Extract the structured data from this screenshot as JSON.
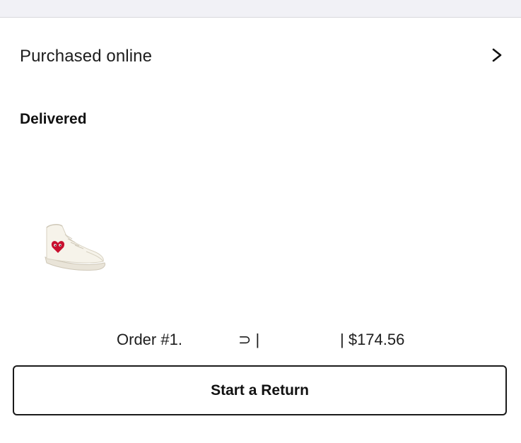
{
  "purchase": {
    "label": "Purchased online",
    "chevron_icon": "chevron-right-icon"
  },
  "order_status": "Delivered",
  "product": {
    "image_icon": "high-top-sneaker-image"
  },
  "order_summary": {
    "order_prefix": "Order #1.",
    "mid_fragment": "⊃ |",
    "price": "| $174.56"
  },
  "actions": {
    "start_return_label": "Start a Return"
  },
  "colors": {
    "top_strip": "#f1f1f6",
    "text": "#1d1d1d",
    "button_border": "#1a1a1a",
    "heart_red": "#c8102e"
  }
}
